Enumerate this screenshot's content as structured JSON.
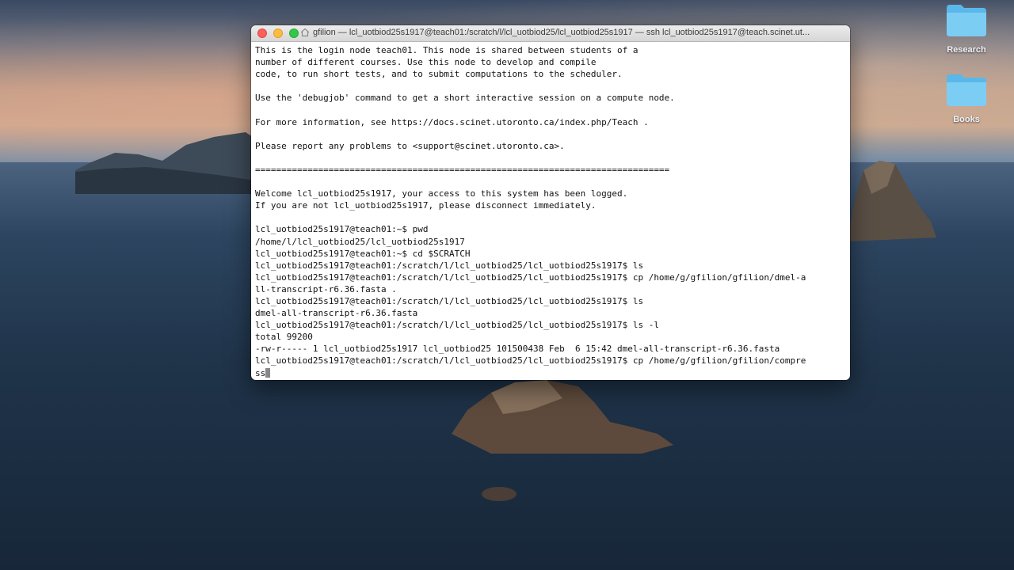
{
  "desktop": {
    "icons": [
      {
        "label": "Research"
      },
      {
        "label": "Books"
      }
    ]
  },
  "terminal": {
    "title": "gfilion — lcl_uotbiod25s1917@teach01:/scratch/l/lcl_uotbiod25/lcl_uotbiod25s1917 — ssh lcl_uotbiod25s1917@teach.scinet.ut...",
    "lines": [
      "This is the login node teach01. This node is shared between students of a",
      "number of different courses. Use this node to develop and compile",
      "code, to run short tests, and to submit computations to the scheduler.",
      "",
      "Use the 'debugjob' command to get a short interactive session on a compute node.",
      "",
      "For more information, see https://docs.scinet.utoronto.ca/index.php/Teach .",
      "",
      "Please report any problems to <support@scinet.utoronto.ca>.",
      "",
      "===============================================================================",
      "",
      "Welcome lcl_uotbiod25s1917, your access to this system has been logged.",
      "If you are not lcl_uotbiod25s1917, please disconnect immediately.",
      "",
      "lcl_uotbiod25s1917@teach01:~$ pwd",
      "/home/l/lcl_uotbiod25/lcl_uotbiod25s1917",
      "lcl_uotbiod25s1917@teach01:~$ cd $SCRATCH",
      "lcl_uotbiod25s1917@teach01:/scratch/l/lcl_uotbiod25/lcl_uotbiod25s1917$ ls",
      "lcl_uotbiod25s1917@teach01:/scratch/l/lcl_uotbiod25/lcl_uotbiod25s1917$ cp /home/g/gfilion/gfilion/dmel-a",
      "ll-transcript-r6.36.fasta .",
      "lcl_uotbiod25s1917@teach01:/scratch/l/lcl_uotbiod25/lcl_uotbiod25s1917$ ls",
      "dmel-all-transcript-r6.36.fasta",
      "lcl_uotbiod25s1917@teach01:/scratch/l/lcl_uotbiod25/lcl_uotbiod25s1917$ ls -l",
      "total 99200",
      "-rw-r----- 1 lcl_uotbiod25s1917 lcl_uotbiod25 101500438 Feb  6 15:42 dmel-all-transcript-r6.36.fasta",
      "lcl_uotbiod25s1917@teach01:/scratch/l/lcl_uotbiod25/lcl_uotbiod25s1917$ cp /home/g/gfilion/gfilion/compre"
    ],
    "current_input": "ss"
  },
  "colors": {
    "close": "#fc605c",
    "minimize": "#fdbc40",
    "maximize": "#34c84a",
    "folder": "#6ec3ef"
  }
}
